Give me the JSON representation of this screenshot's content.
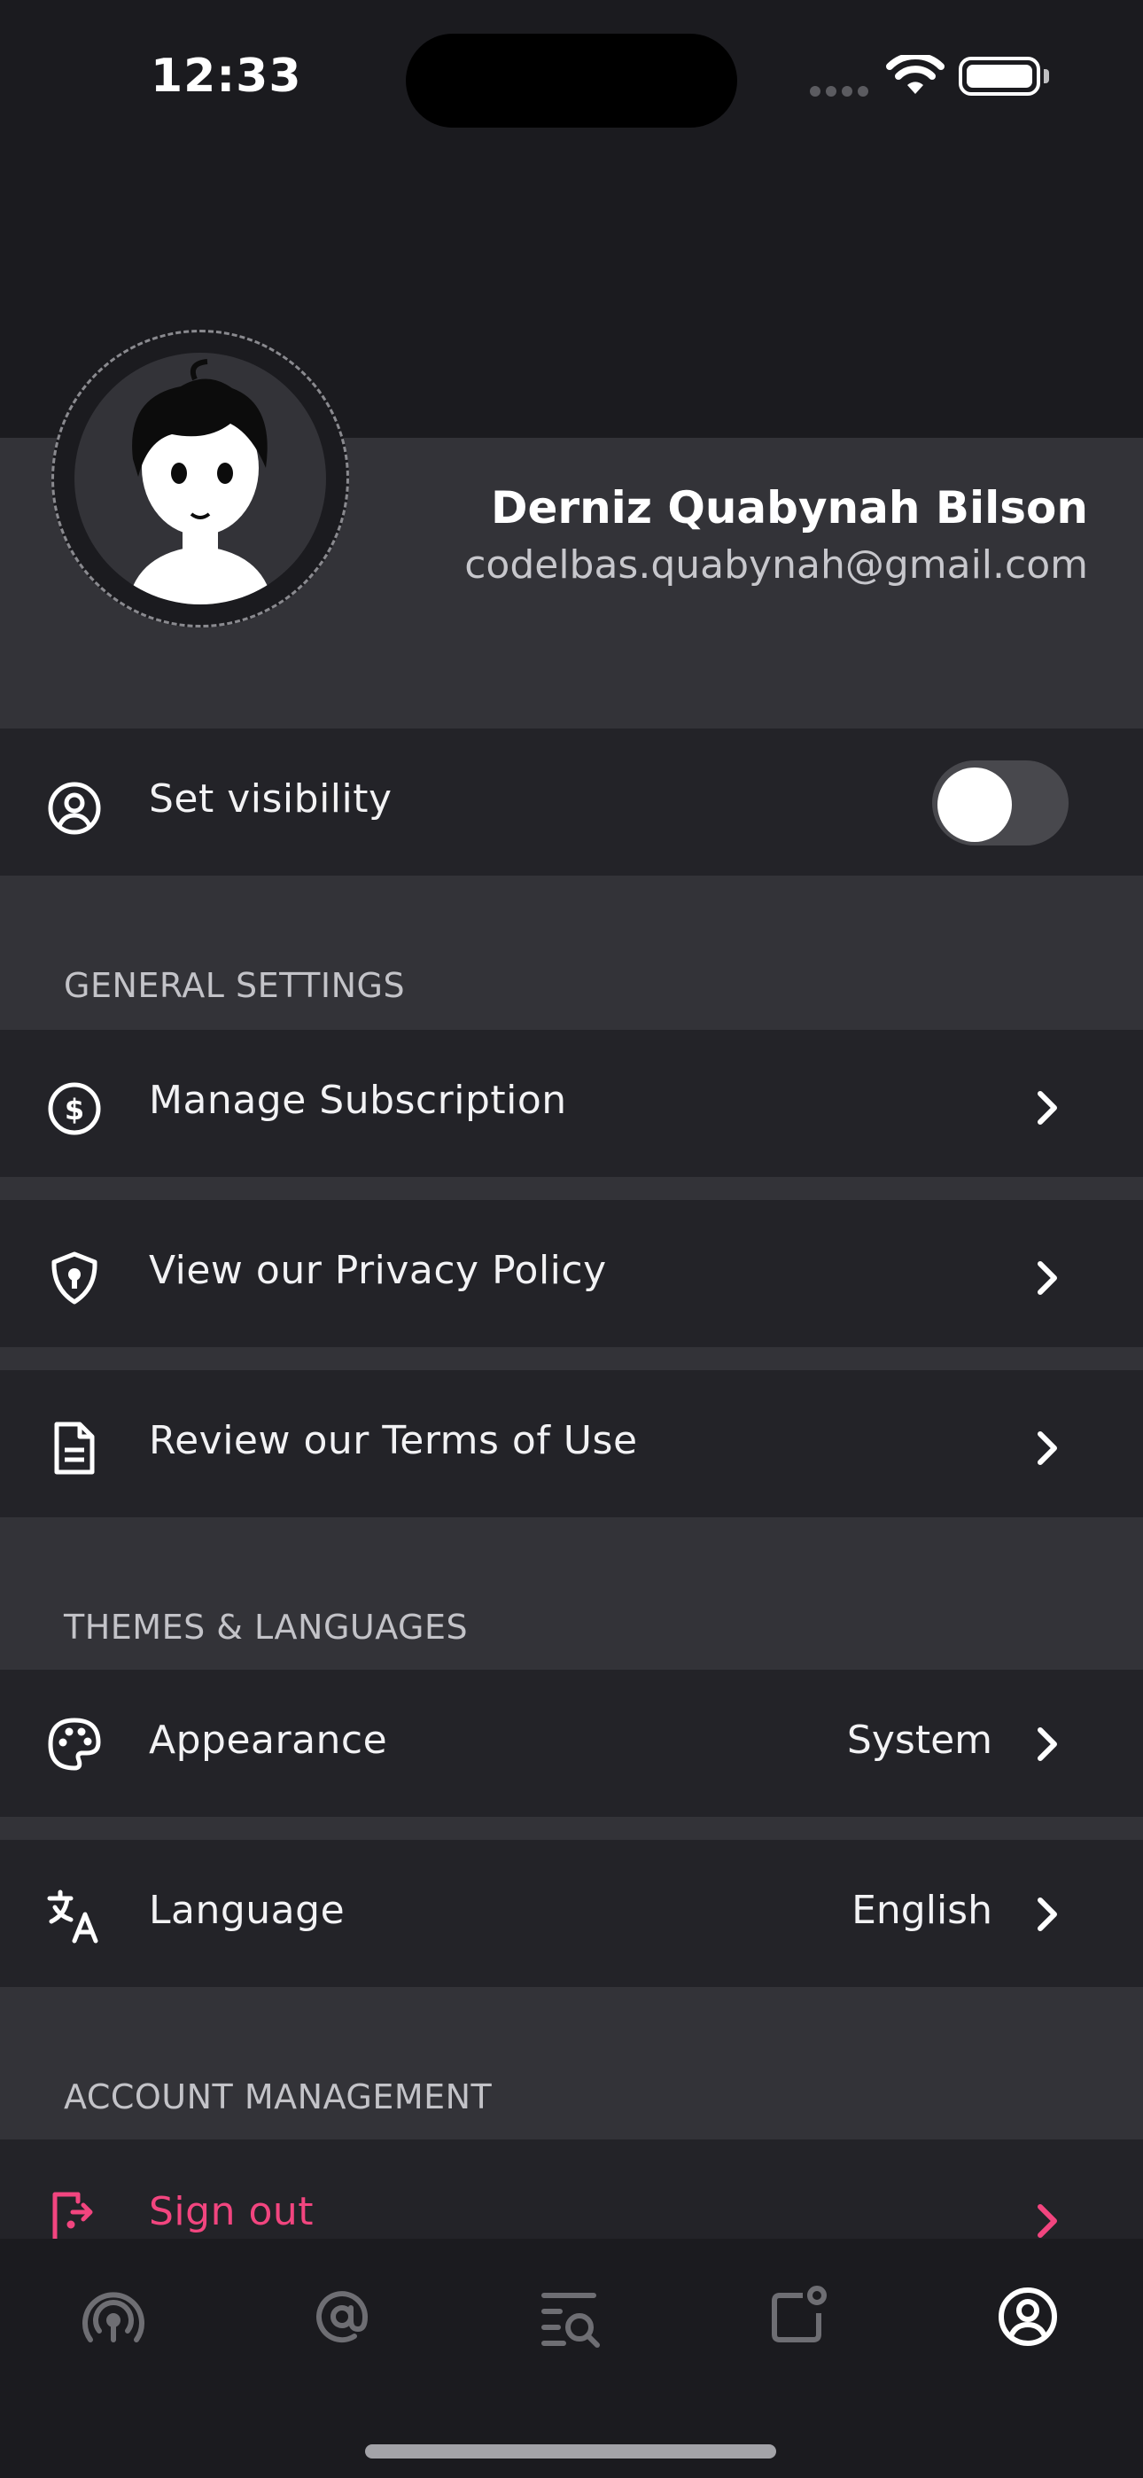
{
  "status_bar": {
    "time": "12:33"
  },
  "profile": {
    "name": "Derniz Quabynah Bilson",
    "email": "codelbas.quabynah@gmail.com"
  },
  "visibility": {
    "label": "Set visibility",
    "enabled": false
  },
  "sections": {
    "general": {
      "title": "GENERAL SETTINGS",
      "items": [
        {
          "label": "Manage Subscription",
          "icon": "dollar-circle-icon"
        },
        {
          "label": "View our Privacy Policy",
          "icon": "shield-lock-icon"
        },
        {
          "label": "Review our Terms of Use",
          "icon": "document-icon"
        }
      ]
    },
    "themes": {
      "title": "THEMES & LANGUAGES",
      "items": [
        {
          "label": "Appearance",
          "value": "System",
          "icon": "palette-icon"
        },
        {
          "label": "Language",
          "value": "English",
          "icon": "translate-icon"
        }
      ]
    },
    "account": {
      "title": "ACCOUNT MANAGEMENT",
      "items": [
        {
          "label": "Sign out",
          "icon": "sign-out-icon"
        }
      ]
    }
  },
  "tab_bar": {
    "tabs": [
      {
        "icon": "podcast-icon",
        "active": false
      },
      {
        "icon": "at-sign-icon",
        "active": false
      },
      {
        "icon": "search-list-icon",
        "active": false
      },
      {
        "icon": "notification-icon",
        "active": false
      },
      {
        "icon": "profile-icon",
        "active": true
      }
    ]
  },
  "colors": {
    "background": "#1b1b1f",
    "row": "#232328",
    "section": "#333338",
    "danger": "#f2457f"
  }
}
